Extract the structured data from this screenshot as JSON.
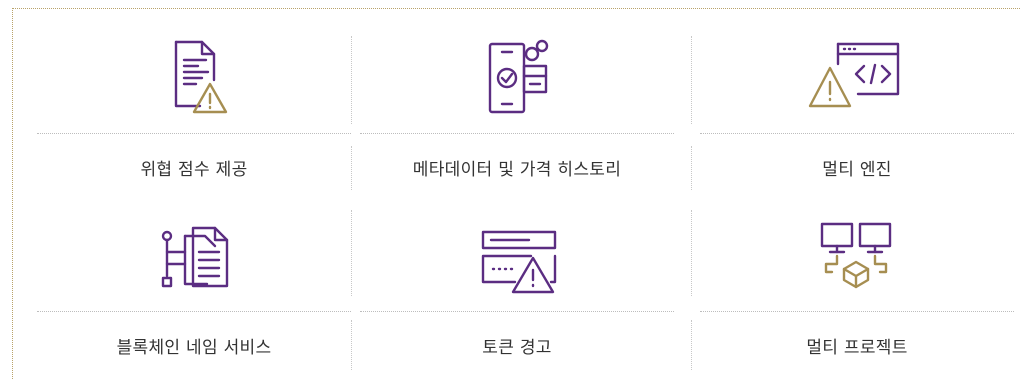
{
  "features": [
    {
      "label": "위협 점수 제공",
      "icon": "document-warning-icon"
    },
    {
      "label": "메타데이터 및 가격 히스토리",
      "icon": "phone-check-data-icon"
    },
    {
      "label": "멀티 엔진",
      "icon": "code-window-warning-icon"
    },
    {
      "label": "블록체인 네임 서비스",
      "icon": "network-documents-icon"
    },
    {
      "label": "토큰 경고",
      "icon": "card-warning-icon"
    },
    {
      "label": "멀티 프로젝트",
      "icon": "monitors-cube-icon"
    }
  ],
  "colors": {
    "primary": "#5b2d82",
    "accent": "#a68e51",
    "text": "#333333",
    "divider": "#bdbdbd"
  }
}
